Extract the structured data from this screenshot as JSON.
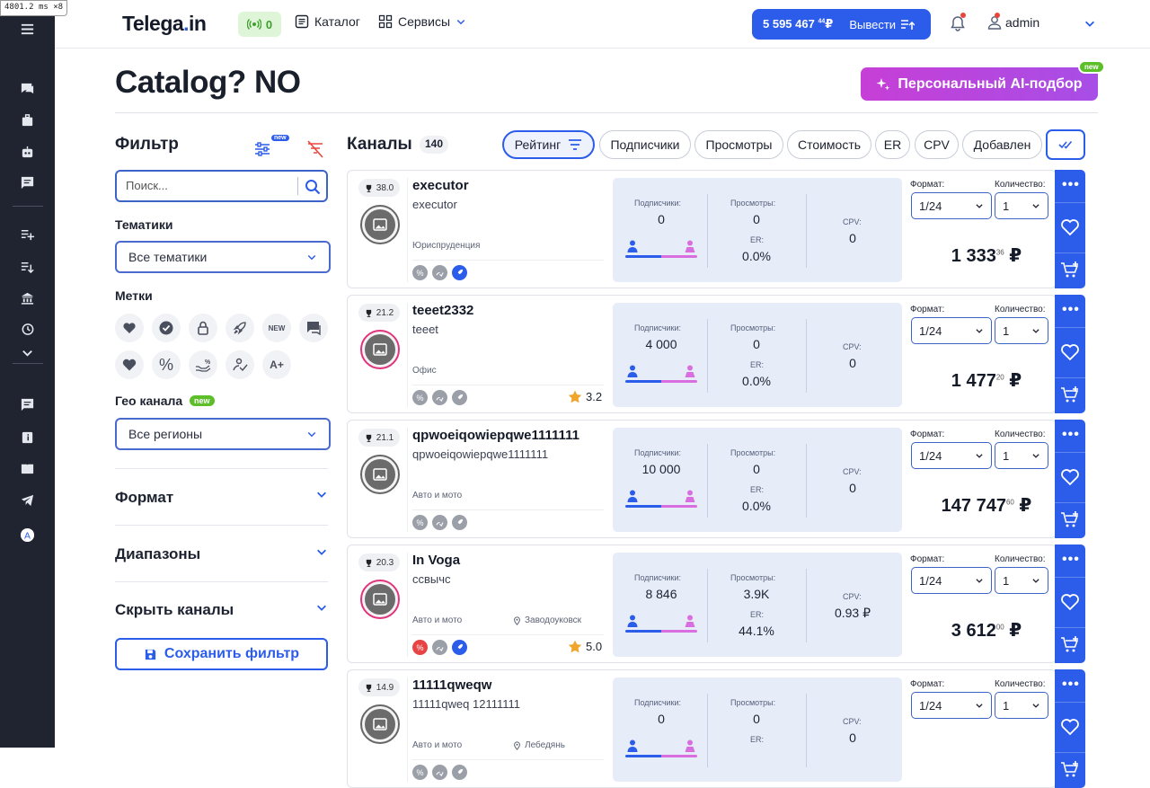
{
  "debug": "4801.2",
  "debug_unit": "ms",
  "debug_extra": "×8",
  "app": {
    "logo_main": "Telega",
    "logo_dot": ".",
    "logo_tail": "in",
    "wifi_count": "0"
  },
  "nav": {
    "catalog": "Каталог",
    "services": "Сервисы"
  },
  "balance": {
    "amount": "5 595 467",
    "cents": "44",
    "currency": "₽",
    "withdraw": "Вывести"
  },
  "user": {
    "name": "admin"
  },
  "page": {
    "title": "Catalog? NO",
    "ai_button": "Персональный AI-подбор",
    "ai_new": "new"
  },
  "filter": {
    "title": "Фильтр",
    "icon_new": "new",
    "search_placeholder": "Поиск...",
    "topics_label": "Тематики",
    "topics_value": "Все тематики",
    "tags_label": "Метки",
    "tag_new_text": "NEW",
    "tag_percent_text": "%",
    "tag_aplus_text": "A+",
    "geo_label": "Гео канала",
    "geo_new": "new",
    "geo_value": "Все регионы",
    "format": "Формат",
    "ranges": "Диапазоны",
    "hide": "Скрыть каналы",
    "save": "Сохранить фильтр"
  },
  "channels": {
    "title": "Каналы",
    "count": "140",
    "sort": [
      "Рейтинг",
      "Подписчики",
      "Просмотры",
      "Стоимость",
      "ER",
      "CPV",
      "Добавлен"
    ]
  },
  "labels": {
    "subs": "Подписчики:",
    "views": "Просмотры:",
    "er": "ER:",
    "cpv": "CPV:",
    "format": "Формат:",
    "qty": "Количество:",
    "format_value": "1/24",
    "qty_value": "1",
    "currency": "₽",
    "mini_percent": "%"
  },
  "cards": [
    {
      "rank": "38.0",
      "name": "executor",
      "sub": "executor",
      "category": "Юриспруденция",
      "geo": "",
      "rating": "",
      "subs": "0",
      "views": "0",
      "er": "0.0%",
      "cpv": "0",
      "price": "1 333",
      "price_cents": "36"
    },
    {
      "rank": "21.2",
      "name": "teeet2332",
      "sub": "teeet",
      "category": "Офис",
      "geo": "",
      "rating": "3.2",
      "subs": "4 000",
      "views": "0",
      "er": "0.0%",
      "cpv": "0",
      "price": "1 477",
      "price_cents": "20"
    },
    {
      "rank": "21.1",
      "name": "qpwoeiqowiepqwe1111111",
      "sub": "qpwoeiqowiepqwe1111111",
      "category": "Авто и мото",
      "geo": "",
      "rating": "",
      "subs": "10 000",
      "views": "0",
      "er": "0.0%",
      "cpv": "0",
      "price": "147 747",
      "price_cents": "60"
    },
    {
      "rank": "20.3",
      "name": "In Voga",
      "sub": "ссвычс",
      "category": "Авто и мото",
      "geo": "Заводоуковск",
      "rating": "5.0",
      "subs": "8 846",
      "views": "3.9K",
      "er": "44.1%",
      "cpv": "0.93 ₽",
      "price": "3 612",
      "price_cents": "00"
    },
    {
      "rank": "14.9",
      "name": "11111qweqw",
      "sub": "11111qweq 12111111",
      "category": "Авто и мото",
      "geo": "Лебедянь",
      "rating": "",
      "subs": "0",
      "views": "0",
      "er": "",
      "cpv": "0",
      "price": "",
      "price_cents": ""
    }
  ]
}
